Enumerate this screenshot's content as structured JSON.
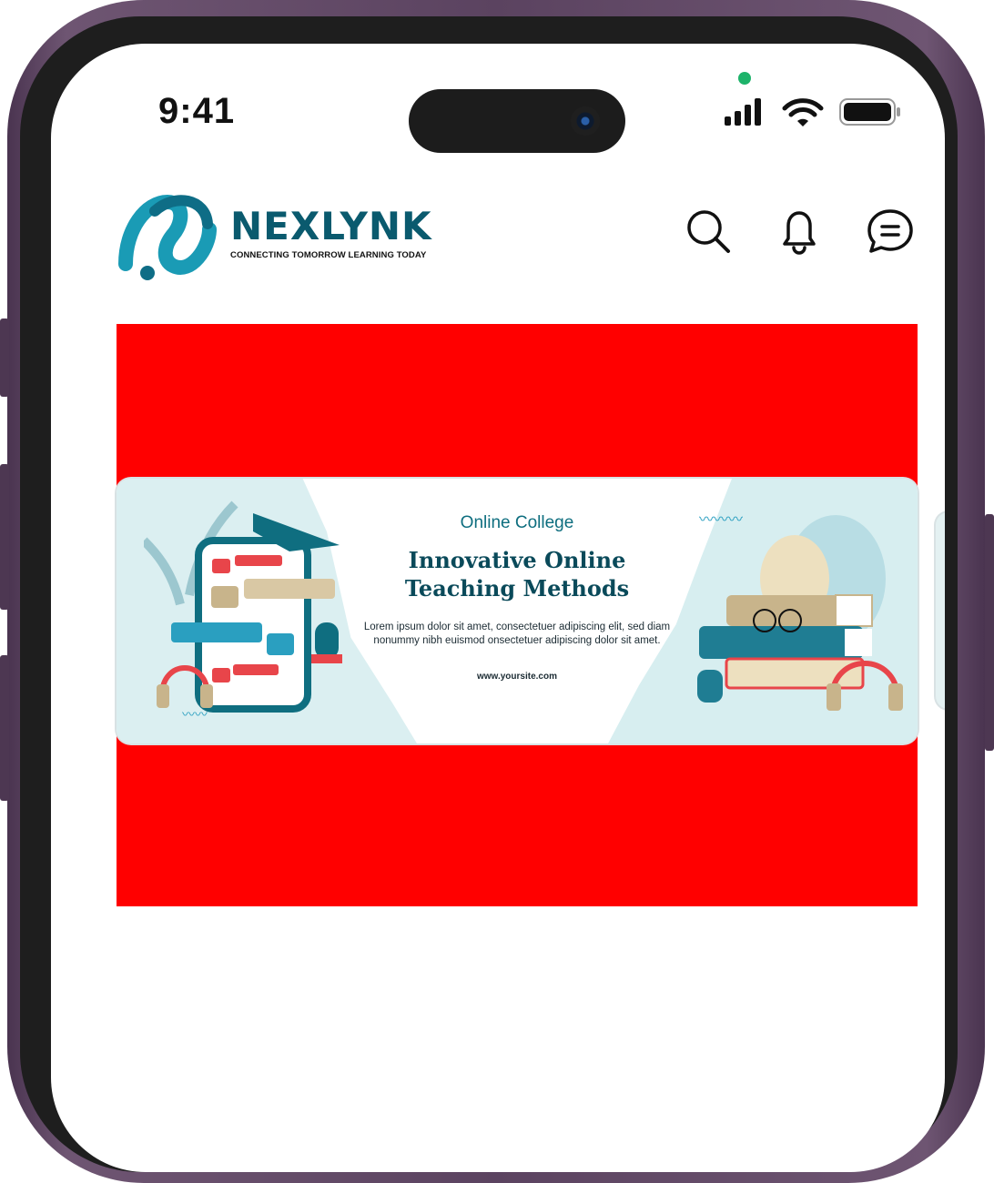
{
  "status_bar": {
    "time": "9:41",
    "icons": [
      "cellular-signal-icon",
      "wifi-icon",
      "battery-icon"
    ],
    "privacy_indicator_color": "#1db36a"
  },
  "header": {
    "logo": {
      "name": "NEXLYNK",
      "tagline": "CONNECTING TOMORROW LEARNING TODAY",
      "brand_color": "#0a5a6e"
    },
    "actions": [
      {
        "icon": "search-icon"
      },
      {
        "icon": "bell-icon"
      },
      {
        "icon": "chat-icon"
      }
    ]
  },
  "banner": {
    "kicker": "Online College",
    "title_line1": "Innovative Online",
    "title_line2": "Teaching Methods",
    "body": "Lorem ipsum dolor sit amet, consectetuer adipiscing elit, sed diam nonummy nibh euismod onsectetuer adipiscing dolor sit amet.",
    "url": "www.yoursite.com"
  },
  "colors": {
    "panel_bg": "#ff0000",
    "banner_teal": "#0a4a5a",
    "banner_light": "#dbeff1"
  }
}
